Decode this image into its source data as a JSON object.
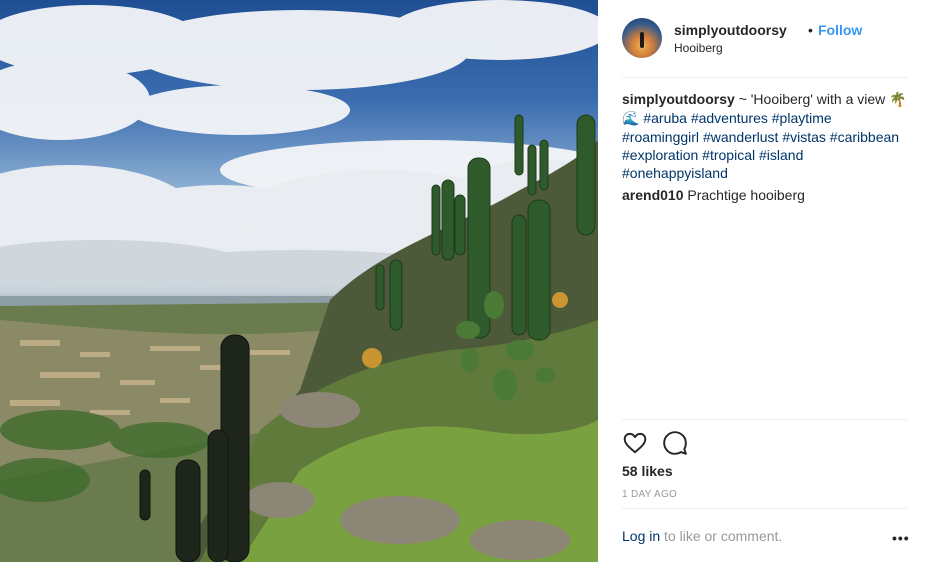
{
  "post": {
    "username": "simplyoutdoorsy",
    "separator": "•",
    "follow_label": "Follow",
    "location": "Hooiberg",
    "caption_user": "simplyoutdoorsy",
    "caption_text": "~ 'Hooiberg' with a view",
    "caption_emoji_1": "🌴",
    "caption_emoji_2": "🌊",
    "hashtags": [
      "#aruba",
      "#adventures",
      "#playtime",
      "#roaminggirl",
      "#wanderlust",
      "#vistas",
      "#caribbean",
      "#exploration",
      "#tropical",
      "#island",
      "#onehappyisland"
    ],
    "comment_user": "arend010",
    "comment_text": "Prachtige hooiberg",
    "likes": "58 likes",
    "timestamp": "1 DAY AGO",
    "login_link": "Log in",
    "login_rest": "to like or comment.",
    "more_label": "•••"
  },
  "icons": {
    "like": "heart-icon",
    "comment": "comment-icon",
    "more": "more-options-icon"
  },
  "colors": {
    "link_blue": "#3897f0",
    "hashtag": "#003569",
    "muted": "#999999",
    "text": "#262626"
  }
}
